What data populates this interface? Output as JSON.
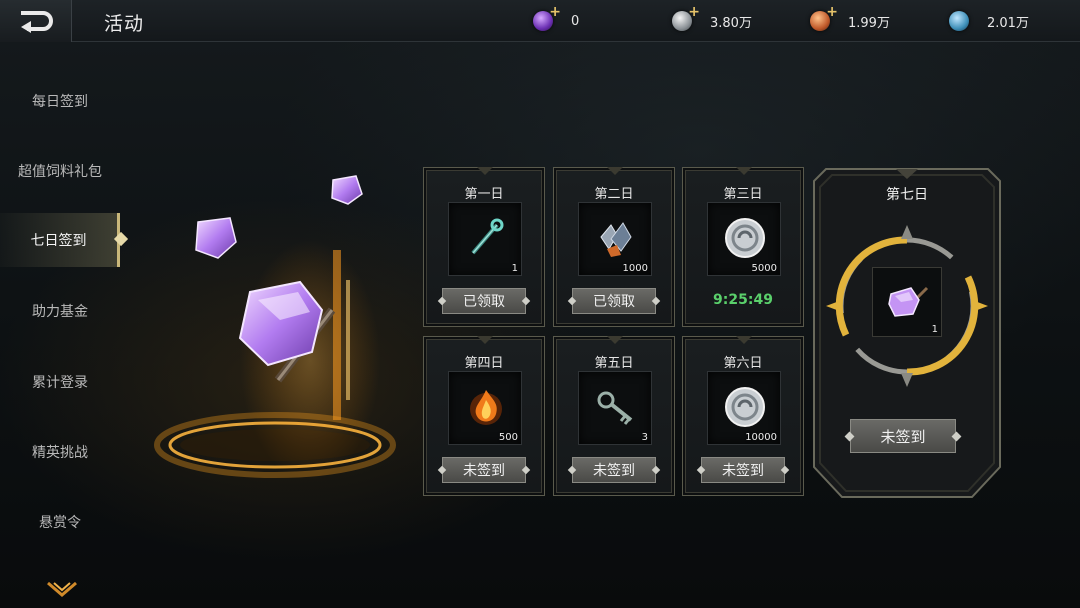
{
  "header": {
    "title": "活动",
    "back_icon": "back-arrow-icon",
    "currencies": [
      {
        "icon": "purple-gem-icon",
        "value": "0",
        "has_add": true,
        "color": "#7a3fc4"
      },
      {
        "icon": "silver-coin-icon",
        "value": "3.80万",
        "has_add": true,
        "color": "#9aa1a6"
      },
      {
        "icon": "bronze-coin-icon",
        "value": "1.99万",
        "has_add": true,
        "color": "#c8652e"
      },
      {
        "icon": "blue-orb-icon",
        "value": "2.01万",
        "has_add": false,
        "color": "#3e8fb8"
      }
    ]
  },
  "sidebar": {
    "items": [
      {
        "label": "每日签到",
        "active": false
      },
      {
        "label": "超值饲料礼包",
        "active": false
      },
      {
        "label": "七日签到",
        "active": true
      },
      {
        "label": "助力基金",
        "active": false
      },
      {
        "label": "累计登录",
        "active": false
      },
      {
        "label": "精英挑战",
        "active": false
      },
      {
        "label": "悬赏令",
        "active": false
      }
    ],
    "more_icon": "chevron-down-icon"
  },
  "days": [
    {
      "label": "第一日",
      "item_icon": "staff-icon",
      "qty": "1",
      "status": "button",
      "button": "已领取"
    },
    {
      "label": "第二日",
      "item_icon": "crystal-ore-icon",
      "qty": "1000",
      "status": "button",
      "button": "已领取"
    },
    {
      "label": "第三日",
      "item_icon": "silver-coin-icon",
      "qty": "5000",
      "status": "timer",
      "timer": "9:25:49"
    },
    {
      "label": "第四日",
      "item_icon": "fire-essence-icon",
      "qty": "500",
      "status": "button",
      "button": "未签到"
    },
    {
      "label": "第五日",
      "item_icon": "key-icon",
      "qty": "3",
      "status": "button",
      "button": "未签到"
    },
    {
      "label": "第六日",
      "item_icon": "silver-coin-icon",
      "qty": "10000",
      "status": "button",
      "button": "未签到"
    }
  ],
  "day7": {
    "label": "第七日",
    "item_icon": "purple-crystal-icon",
    "qty": "1",
    "button": "未签到"
  },
  "colors": {
    "accent_gold": "#e2b33c",
    "timer_green": "#5ad06b",
    "crystal_purple": "#b68cf0"
  }
}
